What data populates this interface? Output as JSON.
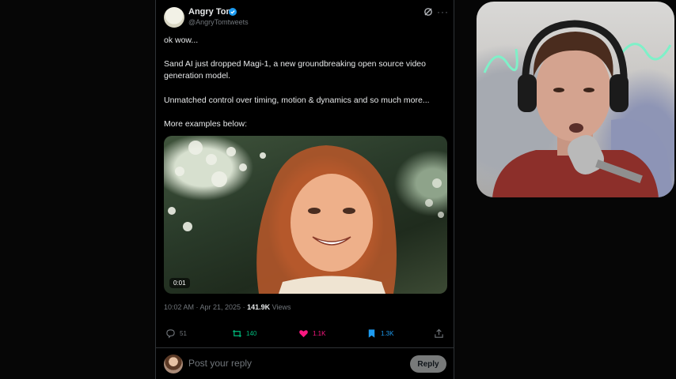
{
  "tweet": {
    "author_name": "Angry Tom",
    "handle": "@AngryTomtweets",
    "avatar_text": "",
    "paragraphs": [
      "ok wow...",
      "Sand AI just dropped Magi-1, a new groundbreaking open source video generation model.",
      "Unmatched control over timing, motion & dynamics and so much more...",
      "More examples below:"
    ],
    "video_time": "0:01",
    "timestamp": "10:02 AM · Apr 21, 2025",
    "separator": " · ",
    "views_count": "141.9K",
    "views_label": "Views",
    "actions": {
      "replies": "51",
      "retweets": "140",
      "likes": "1.1K",
      "bookmarks": "1.3K"
    },
    "reply_placeholder": "Post your reply",
    "reply_button": "Reply"
  },
  "colors": {
    "background": "#000000",
    "text": "#e7e9ea",
    "muted": "#71767b",
    "retweet": "#00ba7c",
    "like": "#f91880",
    "bookmark": "#1d9bf0",
    "verified": "#1d9bf0"
  },
  "icons": [
    "verified-badge-icon",
    "grok-icon",
    "more-options-icon",
    "reply-icon",
    "retweet-icon",
    "like-icon",
    "bookmark-icon",
    "share-icon"
  ]
}
